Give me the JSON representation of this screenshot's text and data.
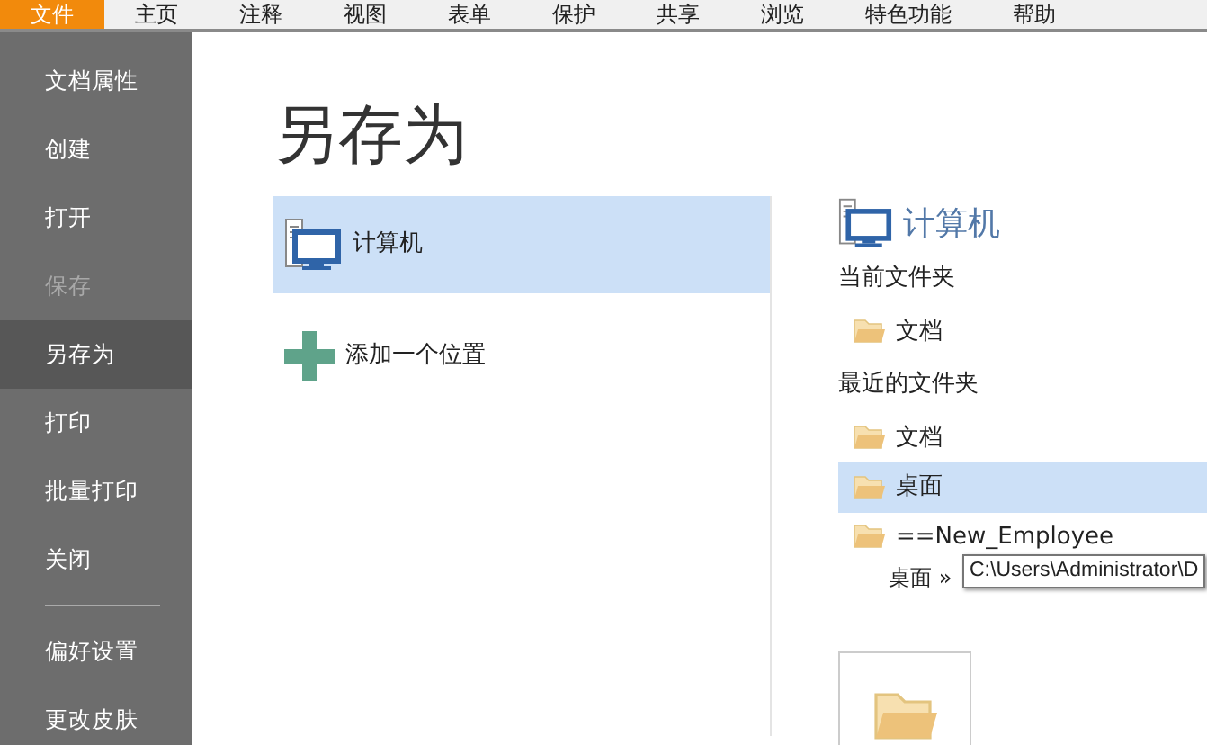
{
  "menu_bar": [
    {
      "label": "文件",
      "selected": true
    },
    {
      "label": "主页",
      "selected": false
    },
    {
      "label": "注释",
      "selected": false
    },
    {
      "label": "视图",
      "selected": false
    },
    {
      "label": "表单",
      "selected": false
    },
    {
      "label": "保护",
      "selected": false
    },
    {
      "label": "共享",
      "selected": false
    },
    {
      "label": "浏览",
      "selected": false
    },
    {
      "label": "特色功能",
      "selected": false
    },
    {
      "label": "帮助",
      "selected": false
    }
  ],
  "sidebar": {
    "items": [
      {
        "label": "文档属性",
        "selected": false,
        "disabled": false
      },
      {
        "label": "创建",
        "selected": false,
        "disabled": false
      },
      {
        "label": "打开",
        "selected": false,
        "disabled": false
      },
      {
        "label": "保存",
        "selected": false,
        "disabled": true
      },
      {
        "label": "另存为",
        "selected": true,
        "disabled": false
      },
      {
        "label": "打印",
        "selected": false,
        "disabled": false
      },
      {
        "label": "批量打印",
        "selected": false,
        "disabled": false
      },
      {
        "label": "关闭",
        "selected": false,
        "disabled": false
      }
    ],
    "bottom_items": [
      {
        "label": "偏好设置"
      },
      {
        "label": "更改皮肤"
      }
    ]
  },
  "page_title": "另存为",
  "locations": [
    {
      "kind": "computer",
      "label": "计算机",
      "selected": true
    },
    {
      "kind": "add",
      "label": "添加一个位置",
      "selected": false
    }
  ],
  "detail": {
    "heading": "计算机",
    "current_label": "当前文件夹",
    "current": [
      {
        "name": "文档",
        "selected": false
      }
    ],
    "recent_label": "最近的文件夹",
    "recent": [
      {
        "name": "文档",
        "selected": false
      },
      {
        "name": "桌面",
        "selected": true
      },
      {
        "name": "==New_Employee",
        "path": "桌面 »",
        "selected": false
      }
    ]
  },
  "tooltip": "C:\\Users\\Administrator\\D"
}
